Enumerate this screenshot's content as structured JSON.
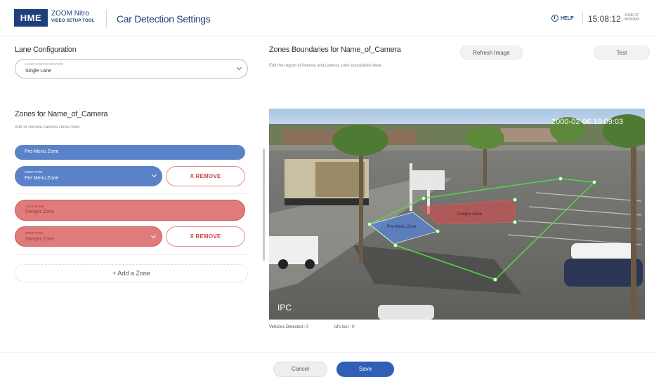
{
  "header": {
    "logo": "HME",
    "product_line1": "ZOOM Nitro",
    "product_line2": "VIDEO SETUP TOOL",
    "title": "Car Detection Settings",
    "help_label": "HELP",
    "time": "15:08:12",
    "date_line1": "JUNE 07",
    "date_line2": "MONDAY"
  },
  "lane": {
    "section_title": "Lane Configuration",
    "field_caption": "LANE CONFIGURATION",
    "value": "Single Lane"
  },
  "zones": {
    "section_title": "Zones for Name_of_Camera",
    "hint": "Add or remove camera zones here.",
    "items": [
      {
        "name_caption": "",
        "name": "Pre-Menu Zone",
        "type_caption": "ZONE TYPE",
        "type": "Pre Menu Zone",
        "remove_label": "X REMOVE"
      },
      {
        "name_caption": "ZONE NAME",
        "name": "Danger Zone",
        "type_caption": "ZONE TYPE",
        "type": "Danger Zone",
        "remove_label": "X REMOVE"
      }
    ],
    "add_label": "+ Add a Zone"
  },
  "boundaries": {
    "section_title": "Zones Boundaries for Name_of_Camera",
    "hint": "Edit the region of interest and camera zone boundaries here.",
    "refresh_label": "Refresh Image",
    "test_label": "Test"
  },
  "camera": {
    "timestamp": "2000-02-06 19:09:03",
    "channel": "IPC",
    "zone_labels": [
      "Pre-Menu Zone",
      "Danger Zone"
    ],
    "vehicles_detected": "Vehicles Detected : 0",
    "ids_lost": "Id's lost : 0"
  },
  "footer": {
    "cancel_label": "Cancel",
    "save_label": "Save"
  },
  "colors": {
    "brand": "#1e3f7a",
    "primary": "#2f5fb7",
    "pre_menu_zone": "#5a82c9",
    "danger_zone": "#e07b7b",
    "roi_line": "#55d84a"
  }
}
